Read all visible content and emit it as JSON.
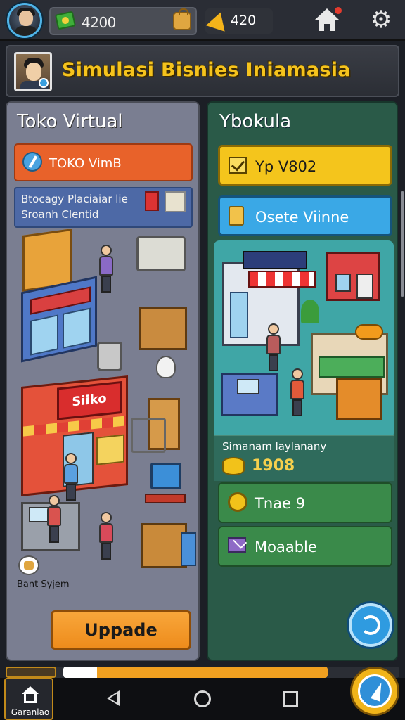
{
  "header": {
    "cash_value": "4200",
    "gem_value": "420",
    "icons": [
      "avatar",
      "cash-icon",
      "bag-icon",
      "gem-icon",
      "home-icon",
      "gear-icon"
    ]
  },
  "title_bar": {
    "title": "Simulasi Bisnies Iniamasia"
  },
  "left_panel": {
    "heading": "Toko Virtual",
    "primary_button": "TOKO VimB",
    "info_line1": "Btocagy Placiaiar lie",
    "info_line2": "Sroanh Clentid",
    "shop_sign": "Siiko",
    "bost_label": "Bant Syjem",
    "upgrade_button": "Uppade"
  },
  "right_panel": {
    "heading": "Ybokula",
    "yellow_button": "Yp V802",
    "blue_button": "Osete Viinne",
    "stat_label": "Simanam laylanany",
    "stat_value": "1908",
    "green_button_1": "Tnae 9",
    "green_button_2": "Moaable"
  },
  "nav": {
    "home_label": "Garanlao"
  },
  "colors": {
    "accent_yellow": "#f4c51c",
    "accent_orange": "#e8622a",
    "accent_blue": "#3aa8e6",
    "panel_left": "#7a7e91",
    "panel_right": "#2a5a48",
    "title_gold": "#f5c31d"
  }
}
